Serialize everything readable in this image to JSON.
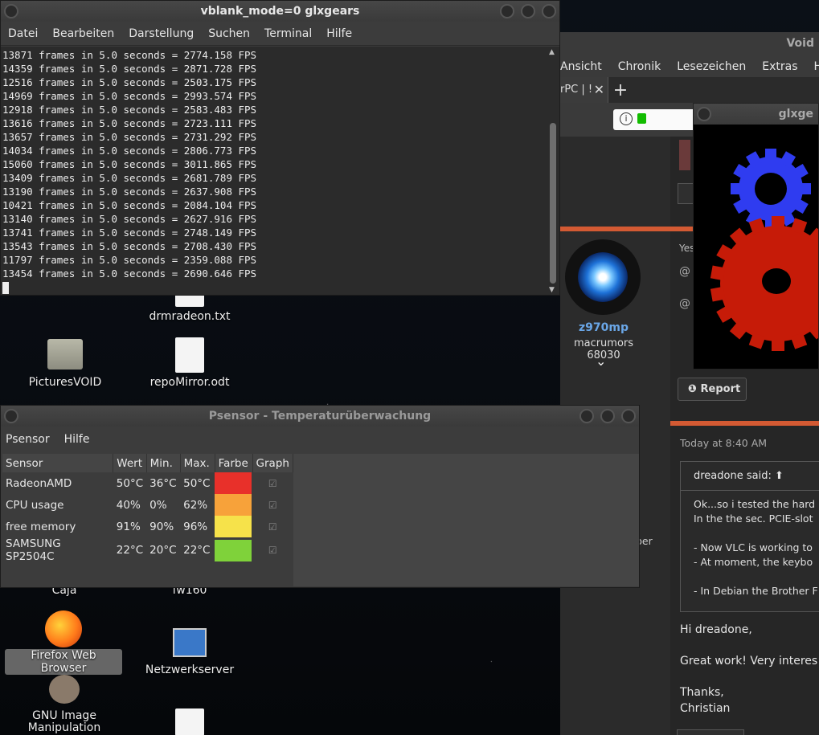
{
  "terminal": {
    "title": "vblank_mode=0 glxgears",
    "menu": [
      "Datei",
      "Bearbeiten",
      "Darstellung",
      "Suchen",
      "Terminal",
      "Hilfe"
    ],
    "lines": [
      "13871 frames in 5.0 seconds = 2774.158 FPS",
      "14359 frames in 5.0 seconds = 2871.728 FPS",
      "12516 frames in 5.0 seconds = 2503.175 FPS",
      "14969 frames in 5.0 seconds = 2993.574 FPS",
      "12918 frames in 5.0 seconds = 2583.483 FPS",
      "13616 frames in 5.0 seconds = 2723.111 FPS",
      "13657 frames in 5.0 seconds = 2731.292 FPS",
      "14034 frames in 5.0 seconds = 2806.773 FPS",
      "15060 frames in 5.0 seconds = 3011.865 FPS",
      "13409 frames in 5.0 seconds = 2681.789 FPS",
      "13190 frames in 5.0 seconds = 2637.908 FPS",
      "10421 frames in 5.0 seconds = 2084.104 FPS",
      "13140 frames in 5.0 seconds = 2627.916 FPS",
      "13741 frames in 5.0 seconds = 2748.149 FPS",
      "13543 frames in 5.0 seconds = 2708.430 FPS",
      "11797 frames in 5.0 seconds = 2359.088 FPS",
      "13454 frames in 5.0 seconds = 2690.646 FPS"
    ]
  },
  "firefox": {
    "title": "Void",
    "menu": [
      "Ansicht",
      "Chronik",
      "Lesezeichen",
      "Extras",
      "Hilfe"
    ],
    "tab_label": "rPC | !",
    "poster": {
      "name": "z970mp",
      "title": "macrumors 68030"
    },
    "report_label": "Report",
    "side_fragments": [
      "Yes",
      "@",
      "@"
    ],
    "partial_label": "ber",
    "post": {
      "timestamp": "Today at 8:40 AM",
      "quote_author": "dreadone said:",
      "quote_lines": [
        "Ok...so i tested the hard",
        "In the the sec. PCIE-slot",
        "",
        "- Now VLC is working to",
        "- At moment, the keybo",
        "",
        "- In Debian the Brother F"
      ],
      "reply_lines": [
        "Hi dreadone,",
        "",
        "Great work! Very interes",
        "",
        "Thanks,",
        "Christian"
      ]
    }
  },
  "gears_window": {
    "title": "glxge"
  },
  "psensor": {
    "title": "Psensor - Temperaturüberwachung",
    "menu": [
      "Psensor",
      "Hilfe"
    ],
    "columns": [
      "Sensor",
      "Wert",
      "Min.",
      "Max.",
      "Farbe",
      "Graph"
    ],
    "rows": [
      {
        "sensor": "RadeonAMD",
        "value": "50°C",
        "min": "36°C",
        "max": "50°C",
        "color": "#e8302a"
      },
      {
        "sensor": "CPU usage",
        "value": "40%",
        "min": "0%",
        "max": "62%",
        "color": "#f7a23a"
      },
      {
        "sensor": "free memory",
        "value": "91%",
        "min": "90%",
        "max": "96%",
        "color": "#f6e24a"
      },
      {
        "sensor": "SAMSUNG SP2504C",
        "value": "22°C",
        "min": "20°C",
        "max": "22°C",
        "color": "#7fd23a"
      }
    ]
  },
  "desktop_icons": [
    {
      "label": "drmradeon.txt"
    },
    {
      "label": "PicturesVOID"
    },
    {
      "label": "repoMirror.odt"
    },
    {
      "label": "Caja"
    },
    {
      "label": "fw160"
    },
    {
      "label": "Firefox Web Browser"
    },
    {
      "label": "Netzwerkserver"
    },
    {
      "label": "GNU Image Manipulation"
    }
  ]
}
